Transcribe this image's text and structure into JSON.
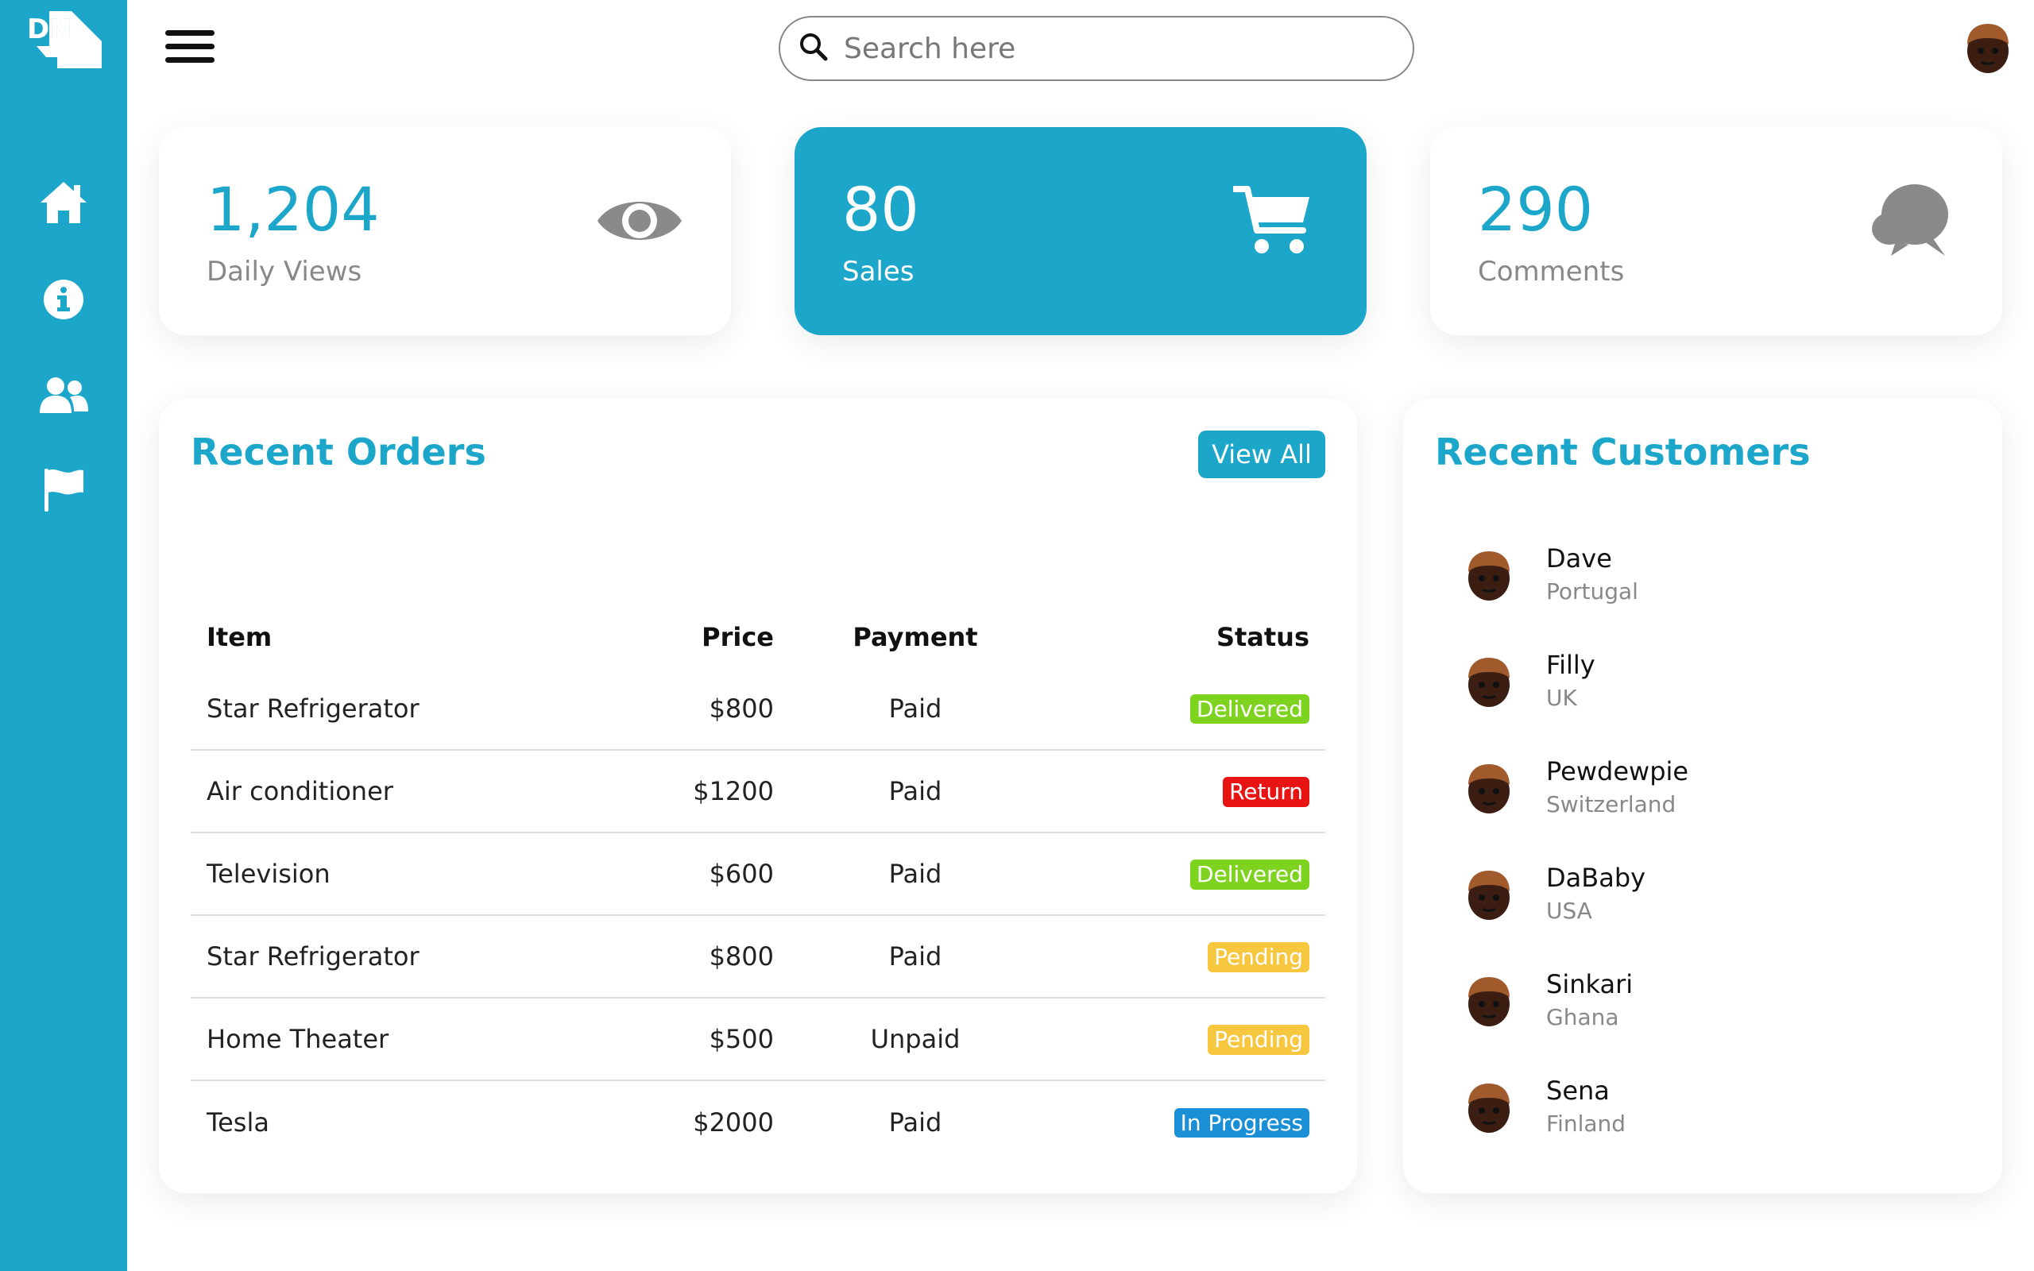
{
  "brand": {
    "logo_text": "DN",
    "accent": "#1ca6ca"
  },
  "sidebar": {
    "items": [
      {
        "icon": "home-icon"
      },
      {
        "icon": "info-icon"
      },
      {
        "icon": "users-icon"
      },
      {
        "icon": "flag-icon"
      }
    ]
  },
  "search": {
    "placeholder": "Search here"
  },
  "cards": [
    {
      "value": "1,204",
      "label": "Daily Views",
      "icon": "eye-icon"
    },
    {
      "value": "80",
      "label": "Sales",
      "icon": "cart-icon"
    },
    {
      "value": "290",
      "label": "Comments",
      "icon": "comments-icon"
    }
  ],
  "orders": {
    "title": "Recent Orders",
    "view_all": "View All",
    "headers": {
      "item": "Item",
      "price": "Price",
      "payment": "Payment",
      "status": "Status"
    },
    "rows": [
      {
        "item": "Star Refrigerator",
        "price": "$800",
        "payment": "Paid",
        "status": "Delivered",
        "status_color": "#7ed321"
      },
      {
        "item": "Air conditioner",
        "price": "$1200",
        "payment": "Paid",
        "status": "Return",
        "status_color": "#e81414"
      },
      {
        "item": "Television",
        "price": "$600",
        "payment": "Paid",
        "status": "Delivered",
        "status_color": "#7ed321"
      },
      {
        "item": "Star Refrigerator",
        "price": "$800",
        "payment": "Paid",
        "status": "Pending",
        "status_color": "#f7c740"
      },
      {
        "item": "Home Theater",
        "price": "$500",
        "payment": "Unpaid",
        "status": "Pending",
        "status_color": "#f7c740"
      },
      {
        "item": "Tesla",
        "price": "$2000",
        "payment": "Paid",
        "status": "In Progress",
        "status_color": "#1b8fd6"
      }
    ]
  },
  "customers": {
    "title": "Recent Customers",
    "list": [
      {
        "name": "Dave",
        "country": "Portugal"
      },
      {
        "name": "Filly",
        "country": "UK"
      },
      {
        "name": "Pewdewpie",
        "country": "Switzerland"
      },
      {
        "name": "DaBaby",
        "country": "USA"
      },
      {
        "name": "Sinkari",
        "country": "Ghana"
      },
      {
        "name": "Sena",
        "country": "Finland"
      }
    ]
  }
}
